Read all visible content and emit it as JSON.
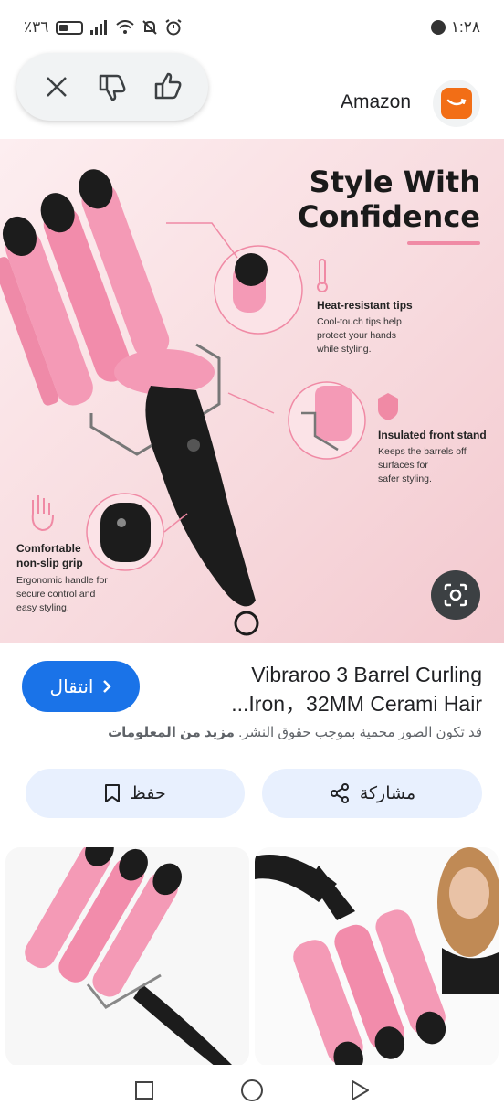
{
  "status_bar": {
    "time": "١:٢٨",
    "battery": "٪٣٦",
    "icons": [
      "messenger-icon",
      "alarm-icon",
      "mute-icon",
      "wifi-icon",
      "signal-icon"
    ]
  },
  "feedback": {
    "icons": [
      "close-icon",
      "thumbs-down-icon",
      "thumbs-up-icon"
    ]
  },
  "source": {
    "name": "Amazon",
    "logo_color": "#f26e16"
  },
  "hero": {
    "headline_line1": "Style With",
    "headline_line2": "Confidence",
    "features": [
      {
        "title": "Heat-resistant tips",
        "desc1": "Cool-touch tips help",
        "desc2": "protect your hands",
        "desc3": "while styling."
      },
      {
        "title": "Insulated front stand",
        "desc1": "Keeps the barrels off",
        "desc2": "surfaces for",
        "desc3": "safer styling."
      },
      {
        "title1": "Comfortable",
        "title2": "non-slip grip",
        "desc1": "Ergonomic handle for",
        "desc2": "secure control and",
        "desc3": "easy styling."
      }
    ],
    "accent_color": "#f08aa5",
    "product_color": "#f48fb1"
  },
  "product": {
    "title_line1": "Vibraroo 3 Barrel Curling",
    "title_line2": "...Iron，32MM Cerami Hair",
    "go_label": "انتقال",
    "copyright_text": "قد تكون الصور محمية بموجب حقوق النشر.",
    "more_info": "مزيد من المعلومات"
  },
  "actions": {
    "share_label": "مشاركة",
    "save_label": "حفظ"
  },
  "colors": {
    "primary_blue": "#1a73e8",
    "action_bg": "#e8f0fe"
  }
}
